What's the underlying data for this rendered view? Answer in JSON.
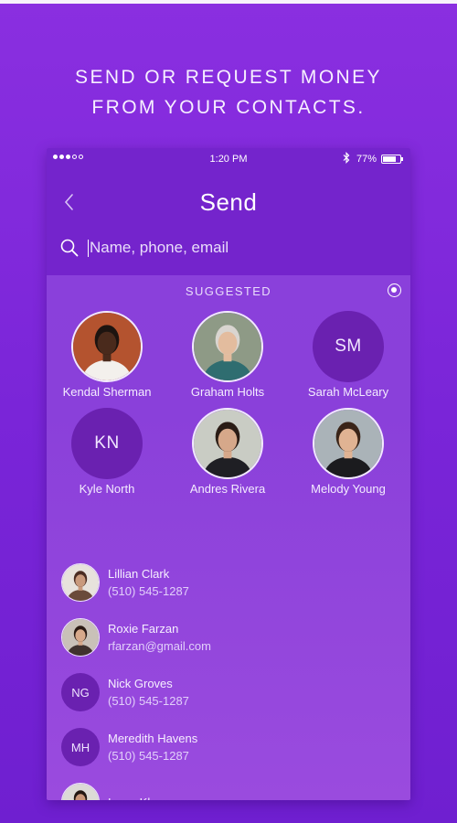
{
  "headline": {
    "line1": "SEND OR REQUEST MONEY",
    "line2": "FROM YOUR CONTACTS."
  },
  "status_bar": {
    "time": "1:20 PM",
    "battery": "77%",
    "battery_level": 0.77
  },
  "screen": {
    "title": "Send"
  },
  "search": {
    "placeholder": "Name, phone, email"
  },
  "suggested": {
    "label": "SUGGESTED",
    "people": [
      {
        "name": "Kendal Sherman",
        "type": "photo",
        "bg": "#b4532f",
        "face": "#4a2a1c",
        "hair": "#1d1410",
        "shirt": "#f3f0ec"
      },
      {
        "name": "Graham Holts",
        "type": "photo",
        "bg": "#8e9a86",
        "face": "#e3bc9e",
        "hair": "#d9d5d0",
        "shirt": "#2f6d70"
      },
      {
        "name": "Sarah McLeary",
        "type": "initials",
        "initials": "SM"
      },
      {
        "name": "Kyle North",
        "type": "initials",
        "initials": "KN"
      },
      {
        "name": "Andres Rivera",
        "type": "photo",
        "bg": "#c9ccc4",
        "face": "#d6a88a",
        "hair": "#2a1c15",
        "shirt": "#1f1f24"
      },
      {
        "name": "Melody Young",
        "type": "photo",
        "bg": "#aab3b8",
        "face": "#e0b393",
        "hair": "#3a2418",
        "shirt": "#1b1b1e"
      }
    ]
  },
  "contacts": [
    {
      "name": "Lillian Clark",
      "detail": "(510) 545-1287",
      "type": "photo",
      "bg": "#e7e2dc",
      "face": "#c99a7d",
      "hair": "#4a2c22",
      "shirt": "#6a4a3a"
    },
    {
      "name": "Roxie Farzan",
      "detail": "rfarzan@gmail.com",
      "type": "photo",
      "bg": "#c9c1b8",
      "face": "#d7a98b",
      "hair": "#2b1a14",
      "shirt": "#40322e"
    },
    {
      "name": "Nick Groves",
      "detail": "(510) 545-1287",
      "type": "initials",
      "initials": "NG"
    },
    {
      "name": "Meredith Havens",
      "detail": "(510) 545-1287",
      "type": "initials",
      "initials": "MH"
    },
    {
      "name": "Isaac Khan",
      "detail": "",
      "type": "photo",
      "bg": "#dcdad6",
      "face": "#c8967a",
      "hair": "#231712",
      "shirt": "#4c4c52"
    }
  ]
}
